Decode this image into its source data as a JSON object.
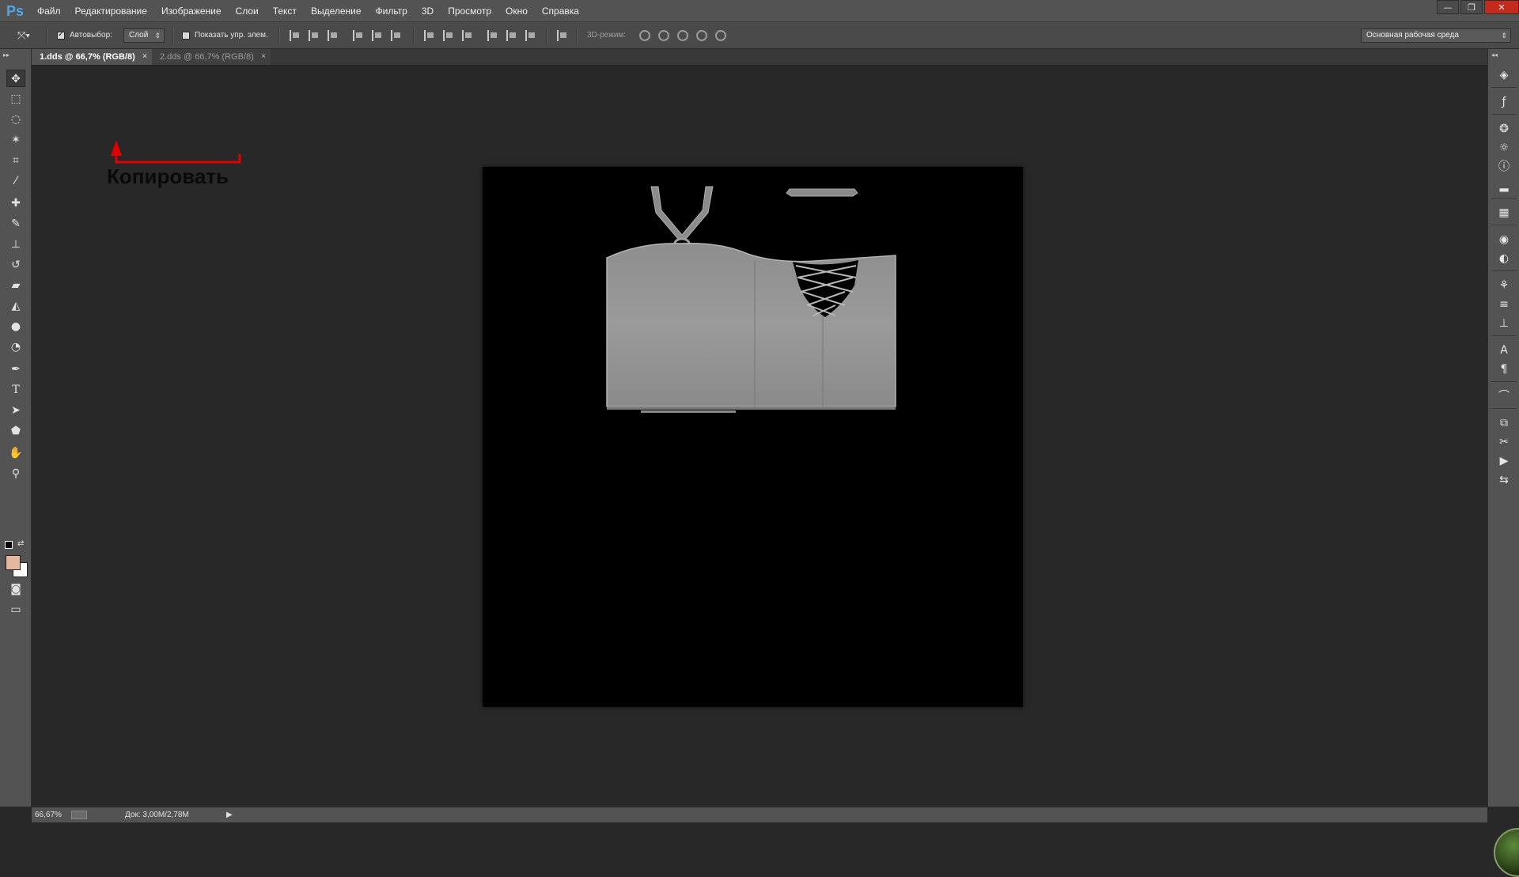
{
  "app": {
    "logo": "Ps"
  },
  "menu": [
    "Файл",
    "Редактирование",
    "Изображение",
    "Слои",
    "Текст",
    "Выделение",
    "Фильтр",
    "3D",
    "Просмотр",
    "Окно",
    "Справка"
  ],
  "window_controls": {
    "minimize": "—",
    "restore": "❐",
    "close": "✕"
  },
  "options": {
    "auto_select_label": "Автовыбор:",
    "auto_select_checked": true,
    "auto_select_value": "Слой",
    "show_transform_label": "Показать упр. элем.",
    "show_transform_checked": false,
    "mode_3d_label": "3D-режим:",
    "workspace_value": "Основная рабочая среда"
  },
  "tabs": [
    {
      "label": "1.dds @ 66,7% (RGB/8)",
      "close": "×",
      "active": true
    },
    {
      "label": "2.dds @ 66,7% (RGB/8)",
      "close": "×",
      "active": false
    }
  ],
  "annotation": {
    "text": "Копировать",
    "color": "#e00000"
  },
  "colors": {
    "foreground": "#e4b8a0",
    "background": "#ffffff"
  },
  "tools": [
    "move-icon",
    "marquee-icon",
    "lasso-icon",
    "magic-wand-icon",
    "crop-icon",
    "eyedropper-icon",
    "healing-brush-icon",
    "brush-icon",
    "clone-stamp-icon",
    "history-brush-icon",
    "eraser-icon",
    "paint-bucket-icon",
    "blur-icon",
    "dodge-icon",
    "pen-icon",
    "type-icon",
    "path-selection-icon",
    "shape-icon",
    "hand-icon",
    "zoom-icon"
  ],
  "dock_icons": [
    "layers-icon",
    "layer-styles-icon",
    "color-icon",
    "adjustments-icon",
    "info-icon",
    "histogram-icon",
    "swatches-icon",
    "styles-icon",
    "navigator-icon",
    "brush-presets-icon",
    "brush-settings-icon",
    "clone-source-icon",
    "character-icon",
    "paragraph-icon",
    "paths-icon",
    "channels-icon",
    "tool-presets-icon",
    "actions-icon",
    "history-icon"
  ],
  "status": {
    "zoom": "66,67%",
    "doc_size": "Док: 3,00M/2,78M",
    "arrow": "▶"
  }
}
